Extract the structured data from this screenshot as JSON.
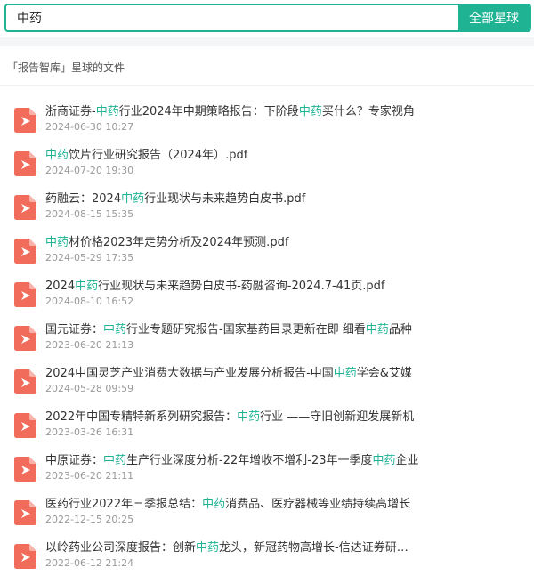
{
  "search": {
    "value": "中药",
    "button_label": "全部星球"
  },
  "section": {
    "title": "「报告智库」星球的文件"
  },
  "highlight_color": "#1fb394",
  "file_icon": "pdf-file-icon",
  "files": [
    {
      "title": "浙商证券-中药行业2024年中期策略报告：下阶段中药买什么？专家视角",
      "date": "2024-06-30 10:27"
    },
    {
      "title": "中药饮片行业研究报告（2024年）.pdf",
      "date": "2024-07-20 19:30"
    },
    {
      "title": "药融云：2024中药行业现状与未来趋势白皮书.pdf",
      "date": "2024-08-15 15:35"
    },
    {
      "title": "中药材价格2023年走势分析及2024年预测.pdf",
      "date": "2024-05-29 17:35"
    },
    {
      "title": "2024中药行业现状与未来趋势白皮书-药融咨询-2024.7-41页.pdf",
      "date": "2024-08-10 16:52"
    },
    {
      "title": "国元证券：中药行业专题研究报告-国家基药目录更新在即 细看中药品种",
      "date": "2023-06-20 21:13"
    },
    {
      "title": "2024中国灵芝产业消费大数据与产业发展分析报告-中国中药学会&艾媒",
      "date": "2024-05-28 09:59"
    },
    {
      "title": "2022年中国专精特新系列研究报告：中药行业 ——守旧创新迎发展新机",
      "date": "2023-03-26 16:31"
    },
    {
      "title": "中原证券：中药生产行业深度分析-22年增收不增利-23年一季度中药企业",
      "date": "2023-06-20 21:11"
    },
    {
      "title": "医药行业2022年三季报总结：中药消费品、医疗器械等业绩持续高增长",
      "date": "2022-12-15 20:25"
    },
    {
      "title": "以岭药业公司深度报告：创新中药龙头，新冠药物高增长-信达证券研究所",
      "date": "2022-06-12 21:24"
    }
  ]
}
